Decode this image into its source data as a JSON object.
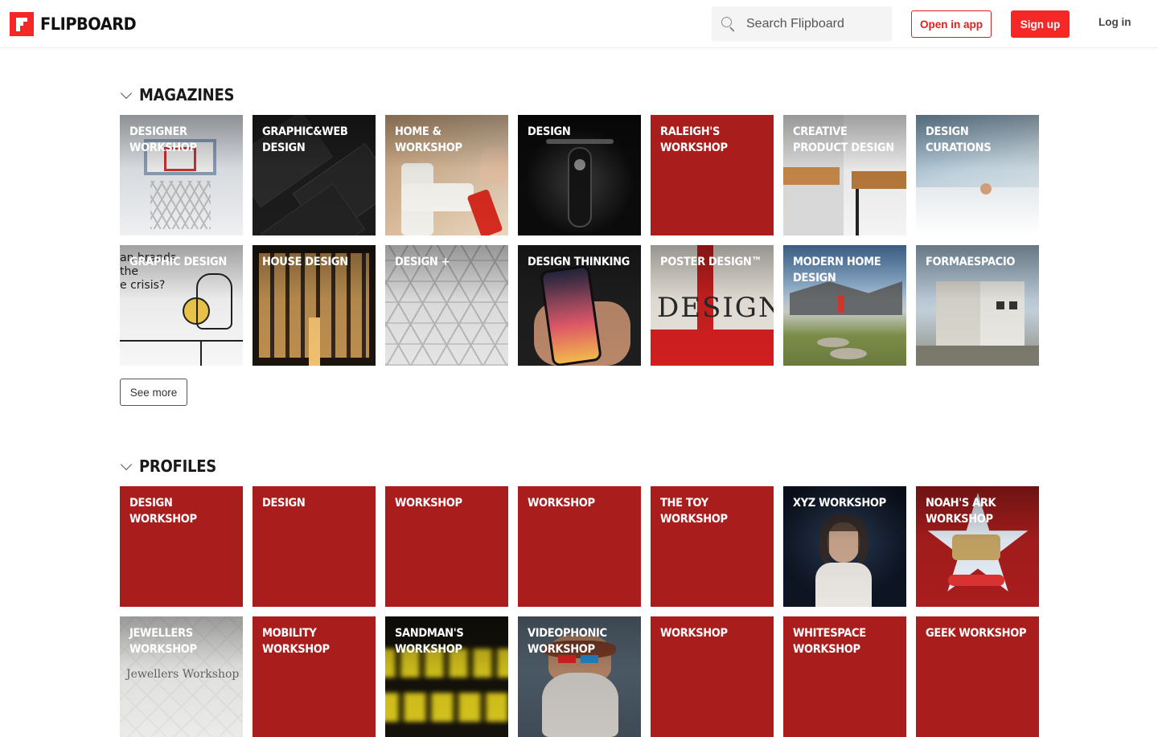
{
  "header": {
    "logo_text": "FLIPBOARD",
    "search_placeholder": "Search Flipboard",
    "open_in_app": "Open in app",
    "sign_up": "Sign up",
    "log_in": "Log in"
  },
  "magazines": {
    "title": "MAGAZINES",
    "see_more": "See more",
    "tiles": [
      {
        "label": "DESIGNER WORKSHOP",
        "art": "basketball-hoop"
      },
      {
        "label": "GRAPHIC&WEB DESIGN",
        "art": "business-cards"
      },
      {
        "label": "HOME & WORKSHOP",
        "art": "pipe-spray"
      },
      {
        "label": "DESIGN",
        "art": "motorcycle"
      },
      {
        "label": "RALEIGH'S WORKSHOP",
        "art": "solid-red"
      },
      {
        "label": "CREATIVE PRODUCT DESIGN",
        "art": "wood-desk"
      },
      {
        "label": "DESIGN CURATIONS",
        "art": "blue-interior"
      },
      {
        "label": "GRAPHIC DESIGN",
        "art": "illustration"
      },
      {
        "label": "HOUSE DESIGN",
        "art": "building-night"
      },
      {
        "label": "DESIGN +",
        "art": "tile-pattern"
      },
      {
        "label": "DESIGN THINKING",
        "art": "phone-hand"
      },
      {
        "label": "POSTER DESIGN™",
        "art": "design-book"
      },
      {
        "label": "MODERN HOME DESIGN",
        "art": "modern-house"
      },
      {
        "label": "FORMAESPACIO",
        "art": "white-building"
      }
    ]
  },
  "profiles": {
    "title": "PROFILES",
    "tiles": [
      {
        "label": "DESIGN WORKSHOP",
        "art": "solid-red"
      },
      {
        "label": "DESIGN",
        "art": "solid-red"
      },
      {
        "label": "WORKSHOP",
        "art": "solid-red"
      },
      {
        "label": "WORKSHOP",
        "art": "solid-red"
      },
      {
        "label": "THE TOY WORKSHOP",
        "art": "solid-red"
      },
      {
        "label": "XYZ WORKSHOP",
        "art": "portrait-dark"
      },
      {
        "label": "NOAH'S ARK WORKSHOP",
        "art": "star-logo"
      },
      {
        "label": "JEWELLERS WORKSHOP",
        "art": "jewellers"
      },
      {
        "label": "MOBILITY WORKSHOP",
        "art": "solid-red"
      },
      {
        "label": "SANDMAN'S WORKSHOP",
        "art": "yellow-blur"
      },
      {
        "label": "VIDEOPHONIC WORKSHOP",
        "art": "bearded-man"
      },
      {
        "label": "WORKSHOP",
        "art": "solid-red"
      },
      {
        "label": "WHITESPACE WORKSHOP",
        "art": "solid-red"
      },
      {
        "label": "GEEK WORKSHOP",
        "art": "solid-red"
      }
    ],
    "jewellers_text": "Jewellers Workshop"
  }
}
